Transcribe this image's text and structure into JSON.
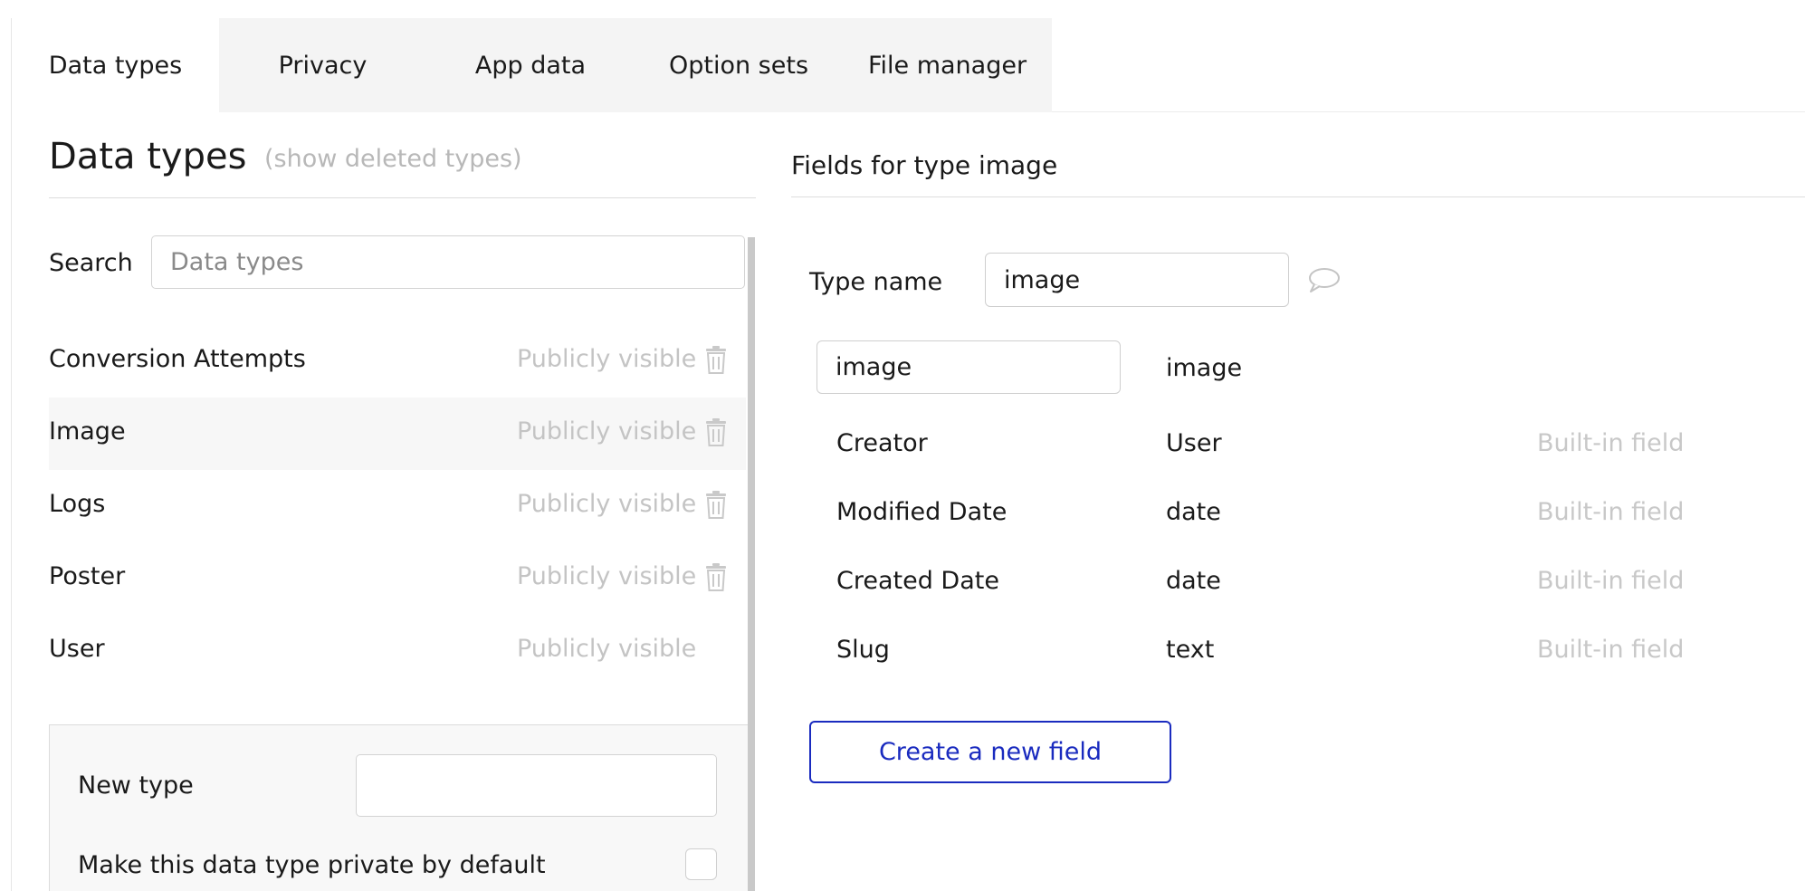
{
  "tabs": [
    {
      "label": "Data types",
      "active": true
    },
    {
      "label": "Privacy",
      "active": false
    },
    {
      "label": "App data",
      "active": false
    },
    {
      "label": "Option sets",
      "active": false
    },
    {
      "label": "File manager",
      "active": false
    }
  ],
  "left_panel": {
    "title": "Data types",
    "show_deleted_link": "(show deleted types)",
    "search": {
      "label": "Search",
      "placeholder": "Data types",
      "value": ""
    },
    "types": [
      {
        "name": "Conversion Attempts",
        "visibility": "Publicly visible",
        "deletable": true,
        "selected": false
      },
      {
        "name": "Image",
        "visibility": "Publicly visible",
        "deletable": true,
        "selected": true
      },
      {
        "name": "Logs",
        "visibility": "Publicly visible",
        "deletable": true,
        "selected": false
      },
      {
        "name": "Poster",
        "visibility": "Publicly visible",
        "deletable": true,
        "selected": false
      },
      {
        "name": "User",
        "visibility": "Publicly visible",
        "deletable": false,
        "selected": false
      }
    ],
    "new_type": {
      "label": "New type",
      "value": "",
      "private_label": "Make this data type private by default",
      "private_checked": false
    }
  },
  "right_panel": {
    "title": "Fields for type image",
    "type_name_label": "Type name",
    "type_name_value": "image",
    "first_field": {
      "name": "image",
      "type": "image"
    },
    "builtin_fields": [
      {
        "name": "Creator",
        "type": "User",
        "note": "Built-in field"
      },
      {
        "name": "Modified Date",
        "type": "date",
        "note": "Built-in field"
      },
      {
        "name": "Created Date",
        "type": "date",
        "note": "Built-in field"
      },
      {
        "name": "Slug",
        "type": "text",
        "note": "Built-in field"
      }
    ],
    "create_button_label": "Create a new field"
  },
  "icons": {
    "trash": "trash-icon",
    "comment": "comment-icon"
  },
  "colors": {
    "accent": "#1a2bbf",
    "muted_text": "#c4c4c4",
    "tab_bg": "#f4f4f4",
    "selected_row_bg": "#f7f7f7"
  }
}
